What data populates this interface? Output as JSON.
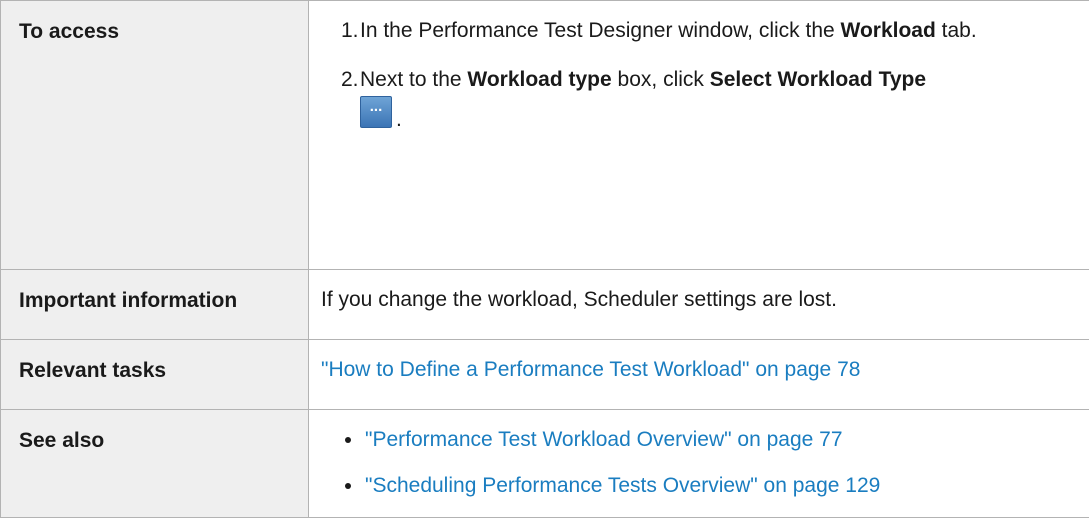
{
  "rows": {
    "access": {
      "label": "To access",
      "steps": [
        {
          "number": "1.",
          "text_before": "In the Performance Test Designer window, click the ",
          "bold": "Workload",
          "text_after": " tab."
        },
        {
          "number": "2.",
          "text_before": "Next to the ",
          "bold1": "Workload type",
          "text_middle": " box, click ",
          "bold2": "Select Workload Type",
          "icon": "ellipsis-button-icon",
          "icon_glyph": "...",
          "text_after": "."
        }
      ]
    },
    "important": {
      "label": "Important information",
      "text": "If you change the workload, Scheduler settings are lost."
    },
    "relevant": {
      "label": "Relevant tasks",
      "link": "\"How to Define a Performance Test Workload\" on page 78"
    },
    "see_also": {
      "label": "See also",
      "links": [
        "\"Performance Test Workload Overview\" on page 77",
        "\"Scheduling Performance Tests Overview\" on page 129"
      ]
    }
  },
  "colors": {
    "link": "#1a7dc0",
    "label_background": "#efefef",
    "border": "#b3b3b3"
  }
}
